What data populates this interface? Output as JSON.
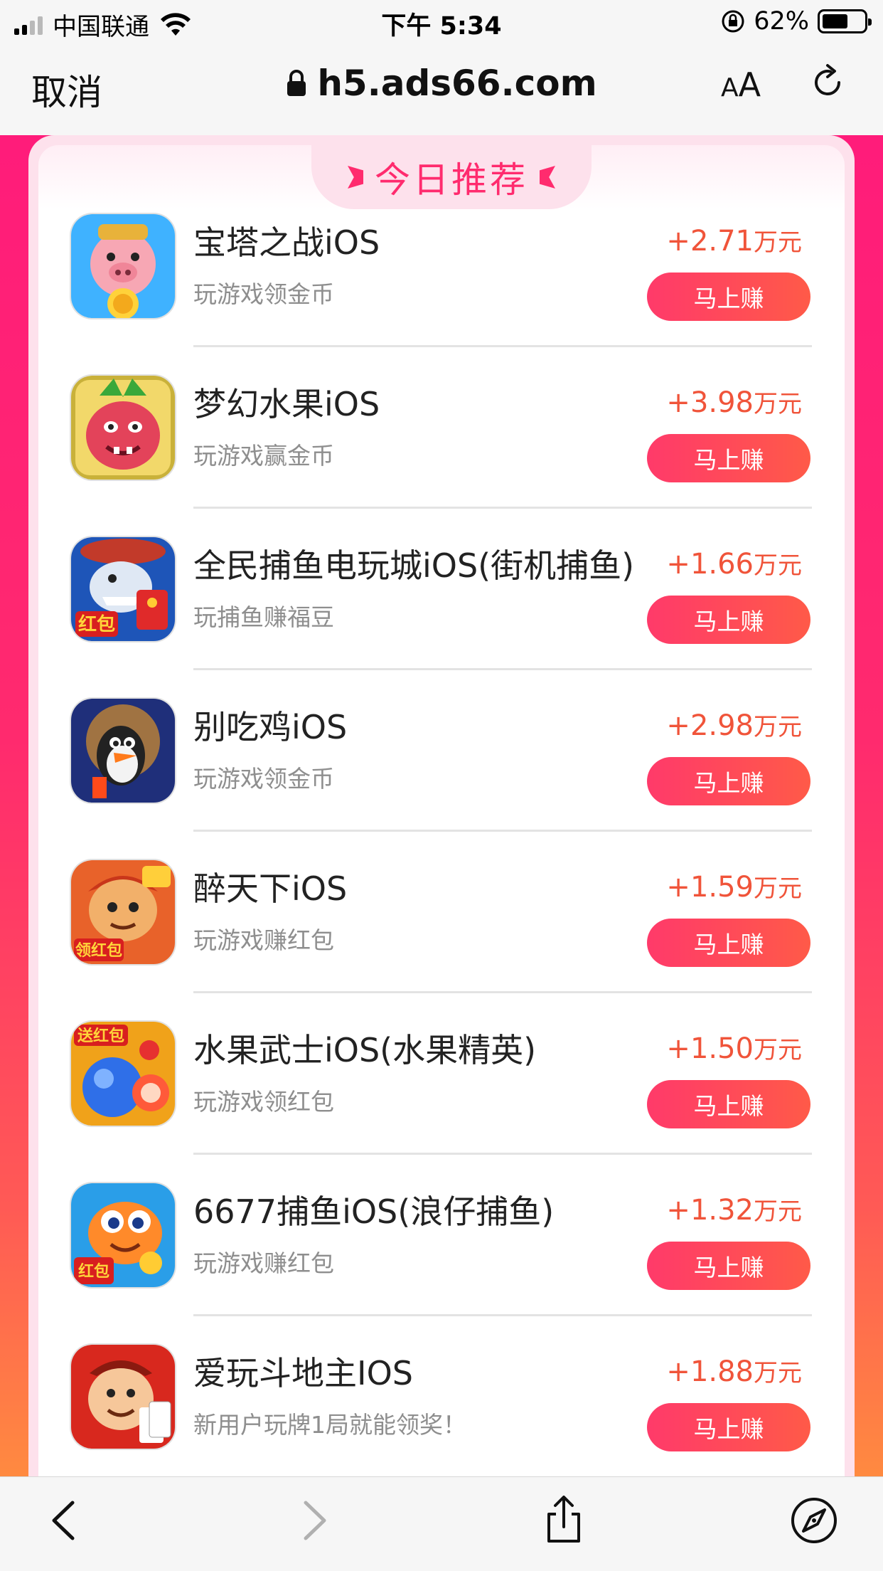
{
  "status": {
    "carrier": "中国联通",
    "time": "下午 5:34",
    "battery": "62%"
  },
  "browser": {
    "cancel": "取消",
    "url": "h5.ads66.com",
    "text_size_small": "A",
    "text_size_large": "A"
  },
  "section": {
    "title": "今日推荐"
  },
  "apps": [
    {
      "name": "宝塔之战iOS",
      "desc": "玩游戏领金币",
      "amount": "+2.71",
      "unit": "万元",
      "button": "马上赚",
      "icon": "pig-god-icon"
    },
    {
      "name": "梦幻水果iOS",
      "desc": "玩游戏赢金币",
      "amount": "+3.98",
      "unit": "万元",
      "button": "马上赚",
      "icon": "radish-monster-icon"
    },
    {
      "name": "全民捕鱼电玩城iOS(街机捕鱼)",
      "desc": "玩捕鱼赚福豆",
      "amount": "+1.66",
      "unit": "万元",
      "button": "马上赚",
      "icon": "shark-redpacket-icon"
    },
    {
      "name": "别吃鸡iOS",
      "desc": "玩游戏领金币",
      "amount": "+2.98",
      "unit": "万元",
      "button": "马上赚",
      "icon": "chicken-icon"
    },
    {
      "name": "醉天下iOS",
      "desc": "玩游戏赚红包",
      "amount": "+1.59",
      "unit": "万元",
      "button": "马上赚",
      "icon": "warrior-redpacket-icon"
    },
    {
      "name": "水果武士iOS(水果精英)",
      "desc": "玩游戏领红包",
      "amount": "+1.50",
      "unit": "万元",
      "button": "马上赚",
      "icon": "fruit-redpacket-icon"
    },
    {
      "name": "6677捕鱼iOS(浪仔捕鱼)",
      "desc": "玩游戏赚红包",
      "amount": "+1.32",
      "unit": "万元",
      "button": "马上赚",
      "icon": "fish-redpacket-icon"
    },
    {
      "name": "爱玩斗地主IOS",
      "desc": "新用户玩牌1局就能领奖！",
      "amount": "+1.88",
      "unit": "万元",
      "button": "马上赚",
      "icon": "landlord-cards-icon"
    }
  ],
  "toolbar": {
    "back_icon": "chevron-left-icon",
    "forward_icon": "chevron-right-icon",
    "share_icon": "share-icon",
    "compass_icon": "compass-icon"
  }
}
